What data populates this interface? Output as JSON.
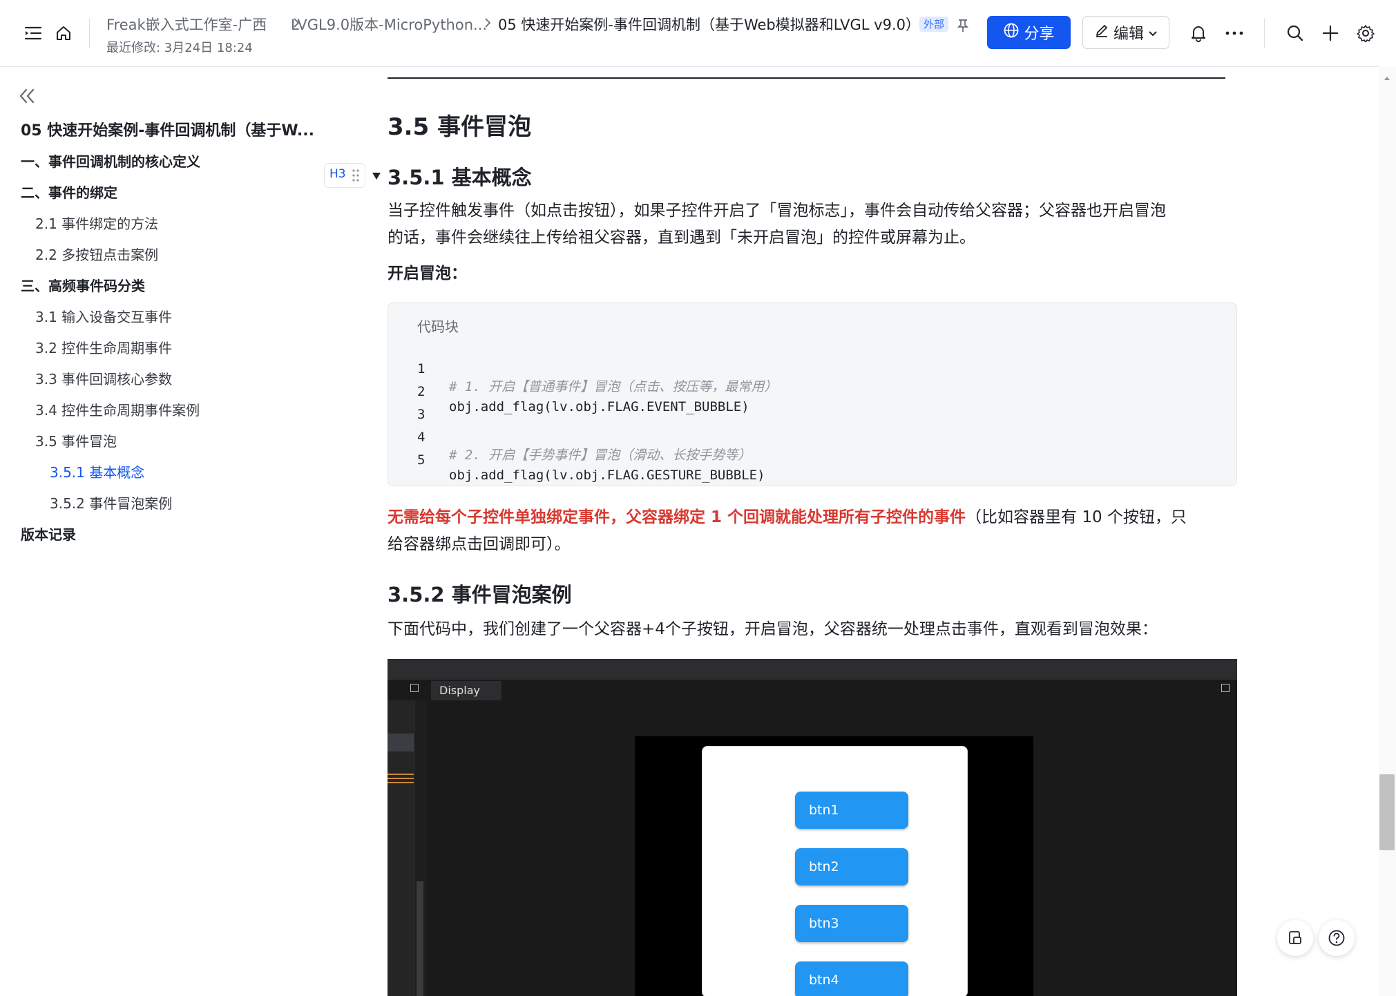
{
  "topbar": {
    "breadcrumbs": [
      "Freak嵌入式工作室-广西",
      "LVGL9.0版本-MicroPython...",
      "05 快速开始案例-事件回调机制（基于Web模拟器和LVGL v9.0）"
    ],
    "last_modified": "最近修改: 3月24日 18:24",
    "external_badge": "外部",
    "share_label": "分享",
    "edit_label": "编辑",
    "more_label": "···"
  },
  "sidebar": {
    "collapse_icon": "double-chevron-left-icon",
    "doc_title": "05 快速开始案例-事件回调机制（基于W...",
    "items": [
      {
        "label": "一、事件回调机制的核心定义"
      },
      {
        "label": "二、事件的绑定"
      },
      {
        "label": "2.1 事件绑定的方法"
      },
      {
        "label": "2.2 多按钮点击案例"
      },
      {
        "label": "三、高频事件码分类"
      },
      {
        "label": "3.1 输入设备交互事件"
      },
      {
        "label": "3.2 控件生命周期事件"
      },
      {
        "label": "3.3 事件回调核心参数"
      },
      {
        "label": "3.4 控件生命周期事件案例"
      },
      {
        "label": "3.5 事件冒泡"
      },
      {
        "label": "3.5.1 基本概念"
      },
      {
        "label": "3.5.2 事件冒泡案例"
      },
      {
        "label": "版本记录"
      }
    ]
  },
  "doc": {
    "h2": "3.5 事件冒泡",
    "heading_badge": "H3",
    "h3_1": "3.5.1 基本概念",
    "para1_line1": "当子控件触发事件（如点击按钮），如果子控件开启了「冒泡标志」，事件会自动传给父容器；父容器也开启冒泡",
    "para1_line2": "的话，事件会继续往上传给祖父容器，直到遇到「未开启冒泡」的控件或屏幕为止。",
    "enable_label": "开启冒泡：",
    "code": {
      "title": "代码块",
      "lines": [
        {
          "n": "1",
          "text": "# 1. 开启【普通事件】冒泡（点击、按压等，最常用）"
        },
        {
          "n": "2",
          "text": "obj.add_flag(lv.obj.FLAG.EVENT_BUBBLE)"
        },
        {
          "n": "3",
          "text": ""
        },
        {
          "n": "4",
          "text": "# 2. 开启【手势事件】冒泡（滑动、长按手势等）"
        },
        {
          "n": "5",
          "text": "obj.add_flag(lv.obj.FLAG.GESTURE_BUBBLE)"
        }
      ]
    },
    "highlight_red": "无需给每个子控件单独绑定事件，父容器绑定 1 个回调就能处理所有子控件的事件",
    "highlight_rest_line1": "（比如容器里有 10 个按钮，只",
    "highlight_rest_line2": "给容器绑点击回调即可）。",
    "h3_2": "3.5.2 事件冒泡案例",
    "para2": "下面代码中，我们创建了一个父容器+4个子按钮，开启冒泡，父容器统一处理点击事件，直观看到冒泡效果：",
    "screenshot": {
      "tab_label": "Display",
      "buttons": [
        "btn1",
        "btn2",
        "btn3",
        "btn4"
      ]
    }
  },
  "colors": {
    "accent": "#1456f0",
    "highlight_red": "#d83931",
    "lvgl_button": "#2196f3"
  }
}
